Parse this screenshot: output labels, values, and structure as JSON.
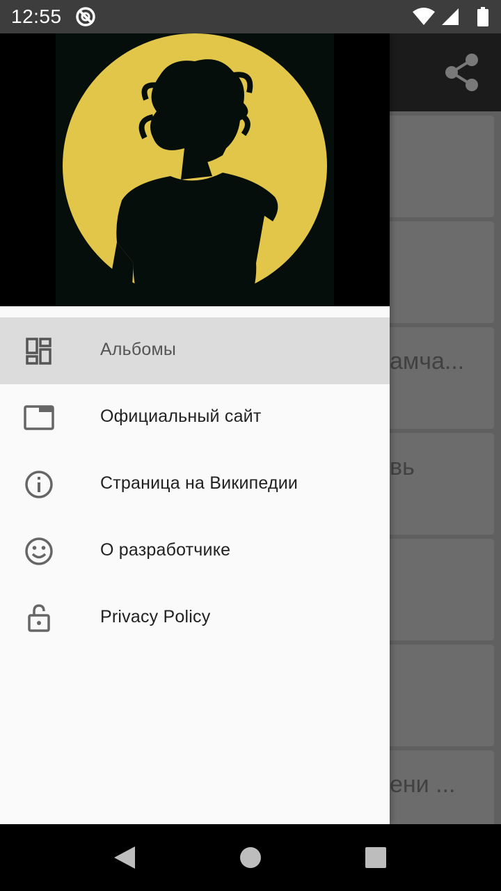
{
  "status_bar": {
    "time": "12:55",
    "icons": [
      "sync-icon",
      "wifi-icon",
      "signal-icon",
      "battery-icon"
    ]
  },
  "background_app": {
    "share_icon": "share-icon",
    "cards": [
      {
        "text": ""
      },
      {
        "text": ""
      },
      {
        "text": "амча..."
      },
      {
        "text": "вь"
      },
      {
        "text": ""
      },
      {
        "text": ""
      },
      {
        "text": "ени ..."
      }
    ]
  },
  "drawer": {
    "header_image": "artist-silhouette-logo",
    "colors": {
      "moon": "#e2c64a",
      "silhouette": "#050e0b"
    },
    "items": [
      {
        "label": "Альбомы",
        "icon": "dashboard-icon",
        "active": true
      },
      {
        "label": "Официальный сайт",
        "icon": "web-window-icon",
        "active": false
      },
      {
        "label": "Страница на Википедии",
        "icon": "info-icon",
        "active": false
      },
      {
        "label": "О разработчике",
        "icon": "smiley-icon",
        "active": false
      },
      {
        "label": "Privacy Policy",
        "icon": "lock-open-icon",
        "active": false
      }
    ]
  },
  "nav_bar": {
    "buttons": [
      "back-icon",
      "home-icon",
      "recent-apps-icon"
    ]
  }
}
